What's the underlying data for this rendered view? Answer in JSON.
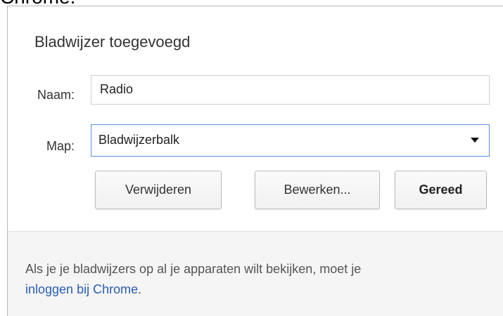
{
  "window": {
    "clipped_top_text": "Chrome."
  },
  "dialog": {
    "title": "Bladwijzer toegevoegd",
    "name_field": {
      "label": "Naam:",
      "value": "Radio"
    },
    "folder_field": {
      "label": "Map:",
      "selected_option": "Bladwijzerbalk"
    },
    "buttons": {
      "remove_label": "Verwijderen",
      "edit_label": "Bewerken...",
      "done_label": "Gereed"
    },
    "footer": {
      "line1_text": "Als je je bladwijzers op al je apparaten wilt bekijken, moet je",
      "signin_link_text": "inloggen bij Chrome",
      "line2_suffix": "."
    }
  },
  "colors": {
    "link": "#2a5db0",
    "focus_border": "#5b8fe0",
    "footer_background": "#f5f5f5"
  },
  "icons": {
    "folder_dropdown": "caret-down-icon"
  }
}
